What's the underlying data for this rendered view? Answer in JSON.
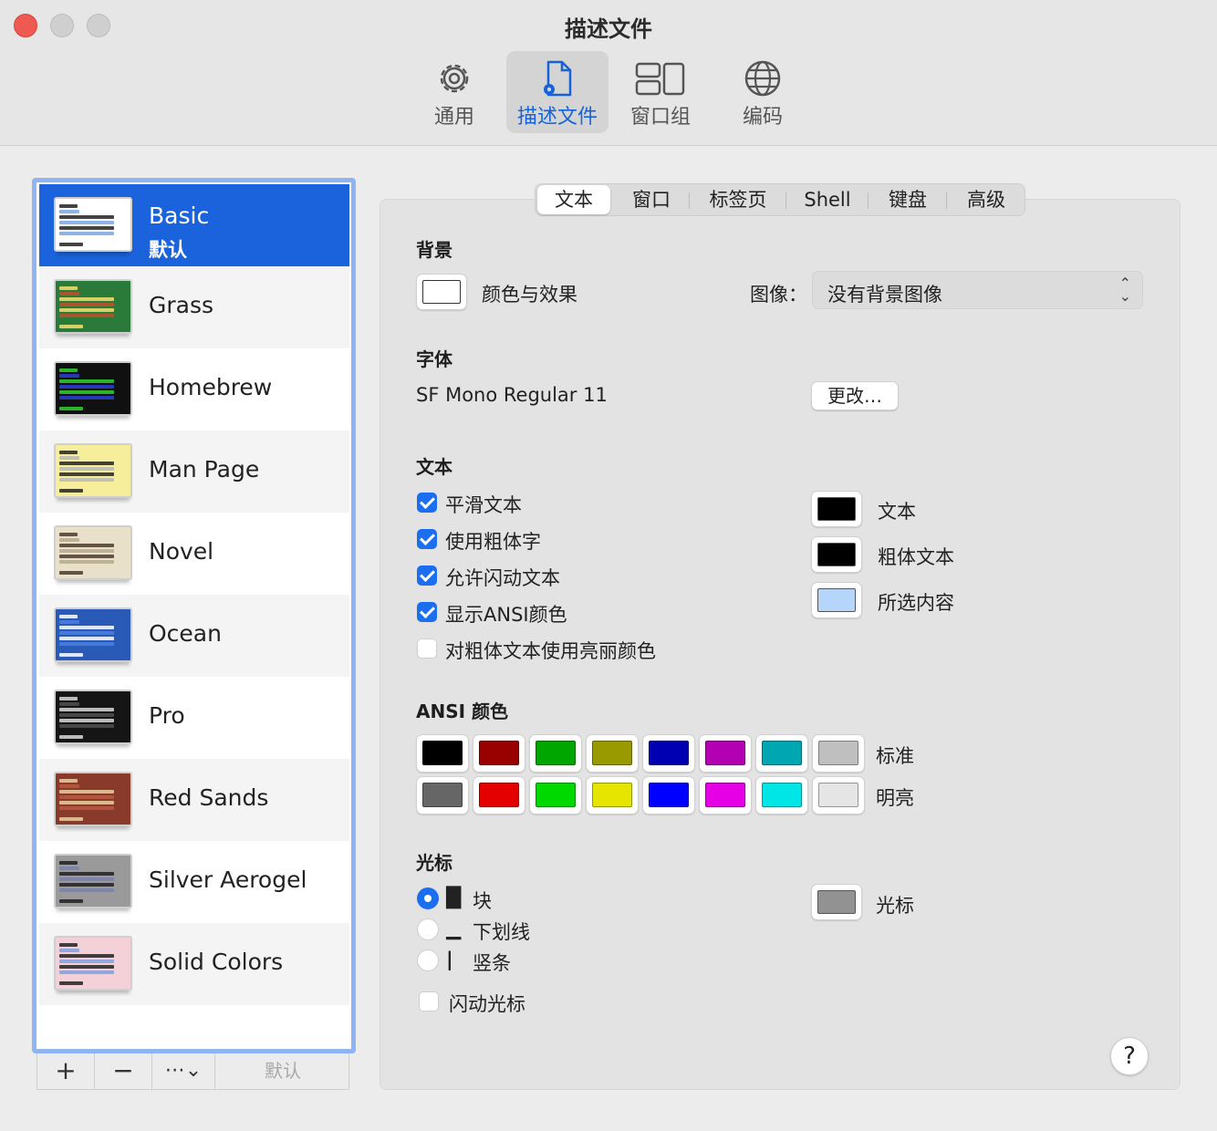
{
  "window": {
    "title": "描述文件"
  },
  "toolbar": {
    "items": [
      {
        "label": "通用",
        "icon": "gear-icon"
      },
      {
        "label": "描述文件",
        "icon": "profile-document-icon",
        "active": true
      },
      {
        "label": "窗口组",
        "icon": "window-groups-icon"
      },
      {
        "label": "编码",
        "icon": "globe-icon"
      }
    ]
  },
  "profiles": {
    "default_label": "默认",
    "items": [
      {
        "name": "Basic",
        "bg": "#ffffff",
        "fg": "#222222",
        "hl": "#7aa6e0"
      },
      {
        "name": "Grass",
        "bg": "#2a7a3a",
        "fg": "#f4e070",
        "hl": "#c0502a"
      },
      {
        "name": "Homebrew",
        "bg": "#101010",
        "fg": "#30d030",
        "hl": "#2a40d0"
      },
      {
        "name": "Man Page",
        "bg": "#f6ee9a",
        "fg": "#222222",
        "hl": "#b8b8b8"
      },
      {
        "name": "Novel",
        "bg": "#e8e0c8",
        "fg": "#4a3a2a",
        "hl": "#b8a890"
      },
      {
        "name": "Ocean",
        "bg": "#2a5ab8",
        "fg": "#ffffff",
        "hl": "#4a80e0"
      },
      {
        "name": "Pro",
        "bg": "#151515",
        "fg": "#d8d8d8",
        "hl": "#505050"
      },
      {
        "name": "Red Sands",
        "bg": "#8a3a2a",
        "fg": "#e8d0a0",
        "hl": "#b85a40"
      },
      {
        "name": "Silver Aerogel",
        "bg": "#9a9a9a",
        "fg": "#202020",
        "hl": "#7a80b0"
      },
      {
        "name": "Solid Colors",
        "bg": "#f4d0d8",
        "fg": "#222222",
        "hl": "#80a0e0"
      }
    ]
  },
  "list_toolbar": {
    "add": "+",
    "remove": "−",
    "more": "⋯⌄",
    "default": "默认"
  },
  "tabs": [
    "文本",
    "窗口",
    "标签页",
    "Shell",
    "键盘",
    "高级"
  ],
  "background": {
    "title": "背景",
    "color_effects": "颜色与效果",
    "image_label": "图像：",
    "image_value": "没有背景图像"
  },
  "font": {
    "title": "字体",
    "value": "SF Mono Regular 11",
    "change": "更改…"
  },
  "text": {
    "title": "文本",
    "options": [
      {
        "label": "平滑文本",
        "checked": true
      },
      {
        "label": "使用粗体字",
        "checked": true
      },
      {
        "label": "允许闪动文本",
        "checked": true
      },
      {
        "label": "显示ANSI颜色",
        "checked": true
      },
      {
        "label": "对粗体文本使用亮丽颜色",
        "checked": false
      }
    ],
    "colors": [
      {
        "label": "文本",
        "color": "#000000"
      },
      {
        "label": "粗体文本",
        "color": "#000000"
      },
      {
        "label": "所选内容",
        "color": "#b5d5fb"
      }
    ]
  },
  "ansi": {
    "title": "ANSI 颜色",
    "standard_label": "标准",
    "bright_label": "明亮",
    "standard": [
      "#000000",
      "#990000",
      "#00a600",
      "#999900",
      "#0000b2",
      "#b200b2",
      "#00a6b2",
      "#bfbfbf"
    ],
    "bright": [
      "#666666",
      "#e50000",
      "#00d900",
      "#e5e500",
      "#0000ff",
      "#e500e5",
      "#00e5e5",
      "#e5e5e5"
    ]
  },
  "cursor": {
    "title": "光标",
    "options": [
      {
        "glyph": "█",
        "label": "块",
        "selected": true
      },
      {
        "glyph": "▁",
        "label": "下划线",
        "selected": false
      },
      {
        "glyph": "|",
        "label": "竖条",
        "selected": false
      }
    ],
    "blink": "闪动光标",
    "color_label": "光标",
    "color": "#929292"
  },
  "help": "?"
}
